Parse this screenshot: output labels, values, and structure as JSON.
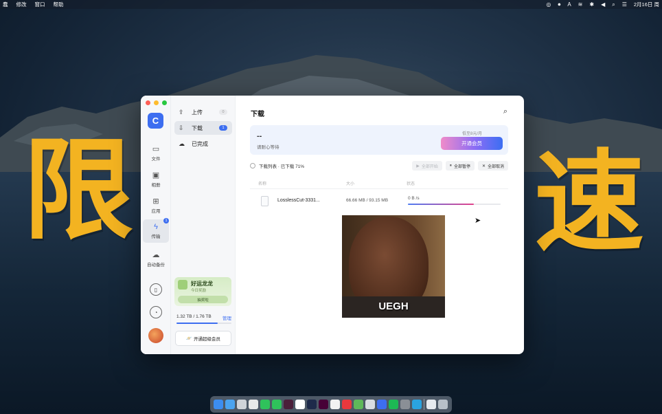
{
  "menubar": {
    "items": [
      "蠢",
      "修改",
      "窗口",
      "帮助"
    ],
    "date": "2月16日 周"
  },
  "overlay": {
    "left_char": "限",
    "right_char": "速"
  },
  "rail": {
    "items": [
      {
        "label": "文件"
      },
      {
        "label": "相册"
      },
      {
        "label": "应用"
      },
      {
        "label": "传输",
        "badge": "1"
      },
      {
        "label": "自动备份"
      }
    ]
  },
  "side": {
    "items": [
      {
        "label": "上传",
        "count": "0"
      },
      {
        "label": "下载",
        "count": "1"
      },
      {
        "label": "已完成"
      }
    ],
    "promo": {
      "title": "好运龙龙",
      "subtitle": "今日奖励",
      "button": "抽奖啦"
    },
    "storage": {
      "text": "1.32 TB / 1.76 TB",
      "manage": "管理",
      "fraction": 0.75
    },
    "vip_button": "开通超级会员"
  },
  "main": {
    "title": "下载",
    "banner": {
      "speed": "--",
      "wait": "请耐心等待",
      "price": "低至8元/月",
      "vip_button": "开通会员"
    },
    "toolbar": {
      "list_label": "下载列表 · 已下载 71%",
      "start_all": "全部开始",
      "pause_all": "全部暂停",
      "cancel_all": "全部取消"
    },
    "table": {
      "headers": {
        "name": "名称",
        "size": "大小",
        "status": "状态"
      },
      "rows": [
        {
          "name": "LosslessCut-3331...",
          "size": "66.66 MB / 93.15 MB",
          "speed": "0 B /s",
          "progress": 0.71
        }
      ]
    }
  },
  "meme": {
    "caption": "UEGH"
  }
}
